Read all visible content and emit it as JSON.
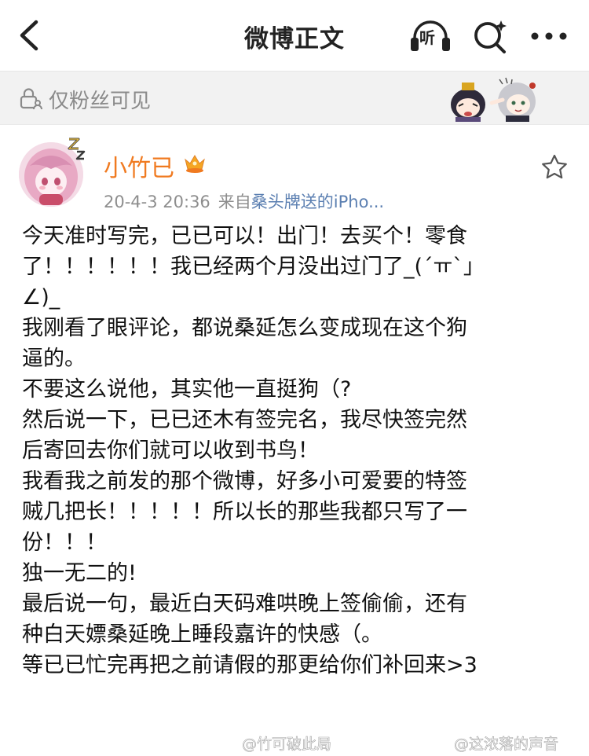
{
  "header": {
    "title": "微博正文",
    "listen_label": "听"
  },
  "visibility": {
    "text": "仅粉丝可见"
  },
  "post": {
    "author": "小竹已",
    "timestamp": "20-4-3 20:36",
    "source_prefix": "来自",
    "source_link": "桑头牌送的iPho...",
    "content_lines": [
      "今天准时写完，已已可以！出门！去买个！零食",
      "了！！！！！！我已经两个月没出过门了_(´ㅠ`」",
      "∠)_",
      "我刚看了眼评论，都说桑延怎么变成现在这个狗",
      "逼的。",
      "不要这么说他，其实他一直挺狗（?",
      "然后说一下，已已还木有签完名，我尽快签完然",
      "后寄回去你们就可以收到书鸟！",
      "我看我之前发的那个微博，好多小可爱要的特签",
      "贼几把长！！！！！所以长的那些我都只写了一",
      "份！！！",
      "独一无二的!",
      "最后说一句，最近白天码难哄晚上签偷偷，还有",
      "种白天嫖桑延晚上睡段嘉许的快感（。",
      "等已已忙完再把之前请假的那更给你们补回来>3"
    ]
  },
  "watermarks": [
    "@竹可破此局",
    "@这浓落的声音"
  ],
  "colors": {
    "accent_username": "#f07a20",
    "link": "#5b7fb1",
    "meta_gray": "#8e8e8e",
    "visibility_bg": "#f2f2f2"
  },
  "icons": {
    "back": "chevron-left-icon",
    "listen": "headphones-listen-icon",
    "search": "search-sparkle-icon",
    "more": "more-dots-icon",
    "visibility": "lock-user-icon",
    "favorite": "star-icon",
    "vip": "vip-crown-badge-icon"
  }
}
